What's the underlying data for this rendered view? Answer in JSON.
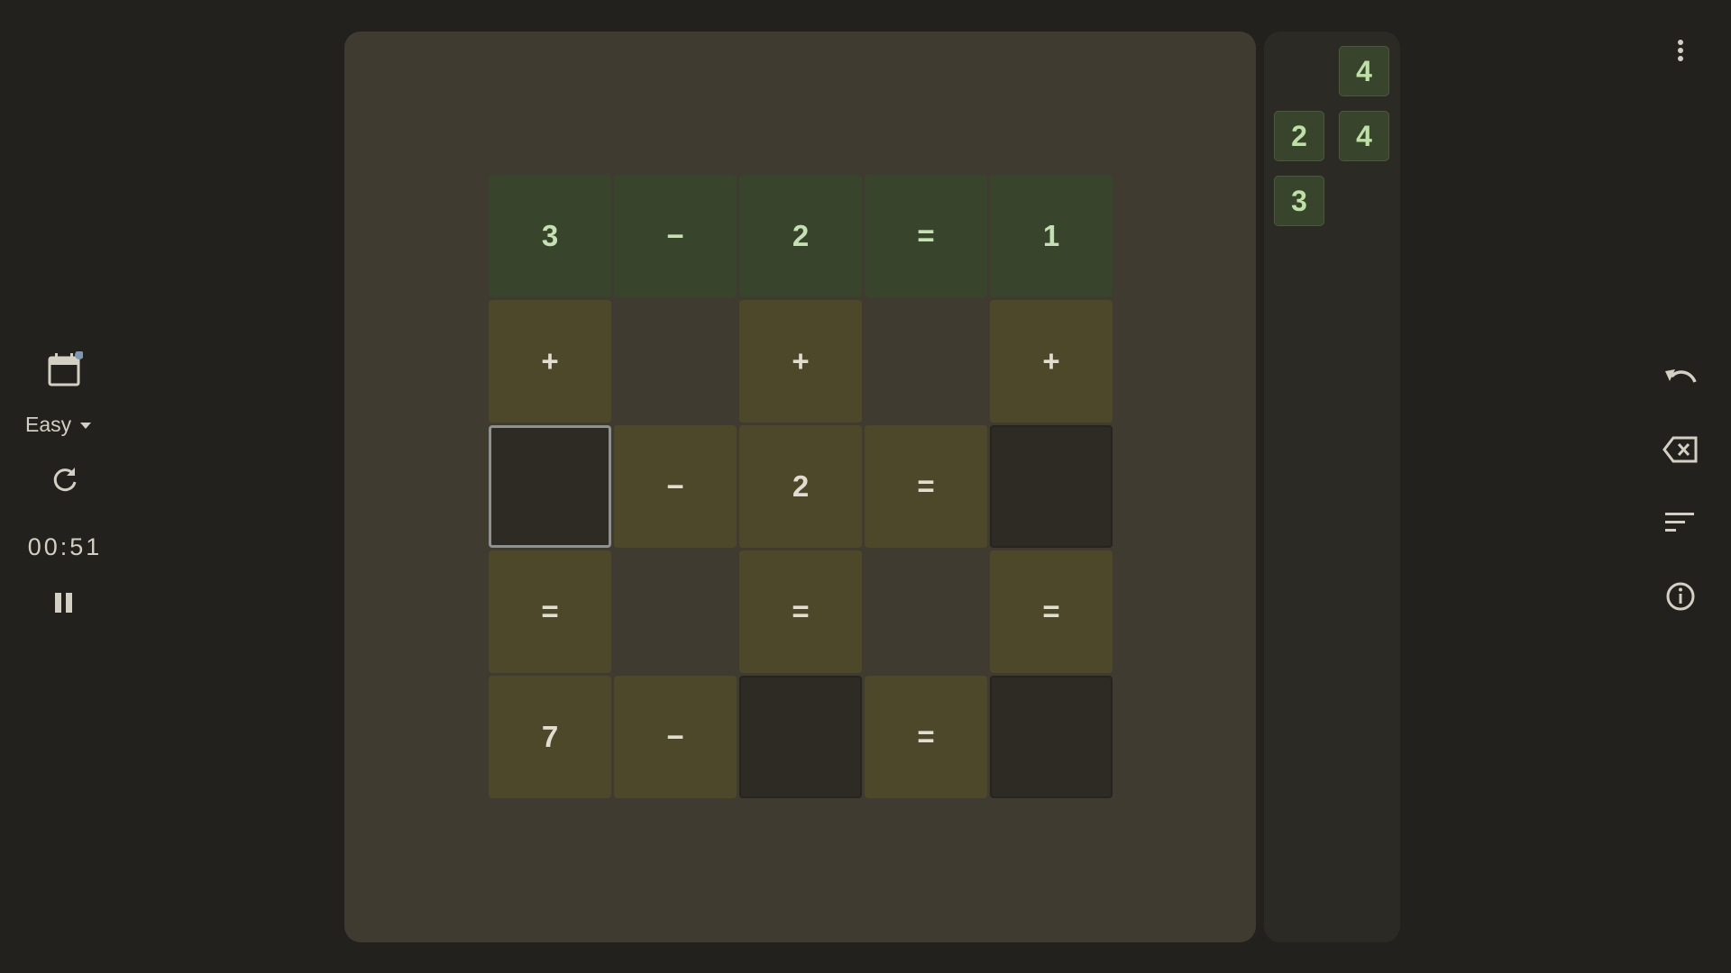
{
  "sidebar": {
    "difficulty": "Easy",
    "timer": "00:51"
  },
  "board": {
    "cells": [
      {
        "v": "3",
        "t": "solved"
      },
      {
        "v": "−",
        "t": "solved"
      },
      {
        "v": "2",
        "t": "solved"
      },
      {
        "v": "=",
        "t": "solved"
      },
      {
        "v": "1",
        "t": "solved"
      },
      {
        "v": "+",
        "t": "clue"
      },
      {
        "v": "",
        "t": "blank"
      },
      {
        "v": "+",
        "t": "clue"
      },
      {
        "v": "",
        "t": "blank"
      },
      {
        "v": "+",
        "t": "clue"
      },
      {
        "v": "",
        "t": "selected"
      },
      {
        "v": "−",
        "t": "clue"
      },
      {
        "v": "2",
        "t": "clue"
      },
      {
        "v": "=",
        "t": "clue"
      },
      {
        "v": "",
        "t": "empty"
      },
      {
        "v": "=",
        "t": "clue"
      },
      {
        "v": "",
        "t": "blank"
      },
      {
        "v": "=",
        "t": "clue"
      },
      {
        "v": "",
        "t": "blank"
      },
      {
        "v": "=",
        "t": "clue"
      },
      {
        "v": "7",
        "t": "clue"
      },
      {
        "v": "−",
        "t": "clue"
      },
      {
        "v": "",
        "t": "empty"
      },
      {
        "v": "=",
        "t": "clue"
      },
      {
        "v": "",
        "t": "empty"
      }
    ]
  },
  "tray": {
    "tiles": [
      "4",
      "2",
      "4",
      "3"
    ]
  },
  "colors": {
    "background": "#23211d",
    "board": "#403b30",
    "solved_cell": "#38442c",
    "clue_cell": "#4d4829",
    "empty_cell": "#2e2b25",
    "tile_text": "#bde0a4",
    "notification_dot": "#7f98b1"
  },
  "icons": [
    "calendar-icon",
    "dropdown-arrow-icon",
    "restart-icon",
    "pause-icon",
    "more-vert-icon",
    "undo-icon",
    "backspace-icon",
    "sort-icon",
    "info-icon"
  ]
}
